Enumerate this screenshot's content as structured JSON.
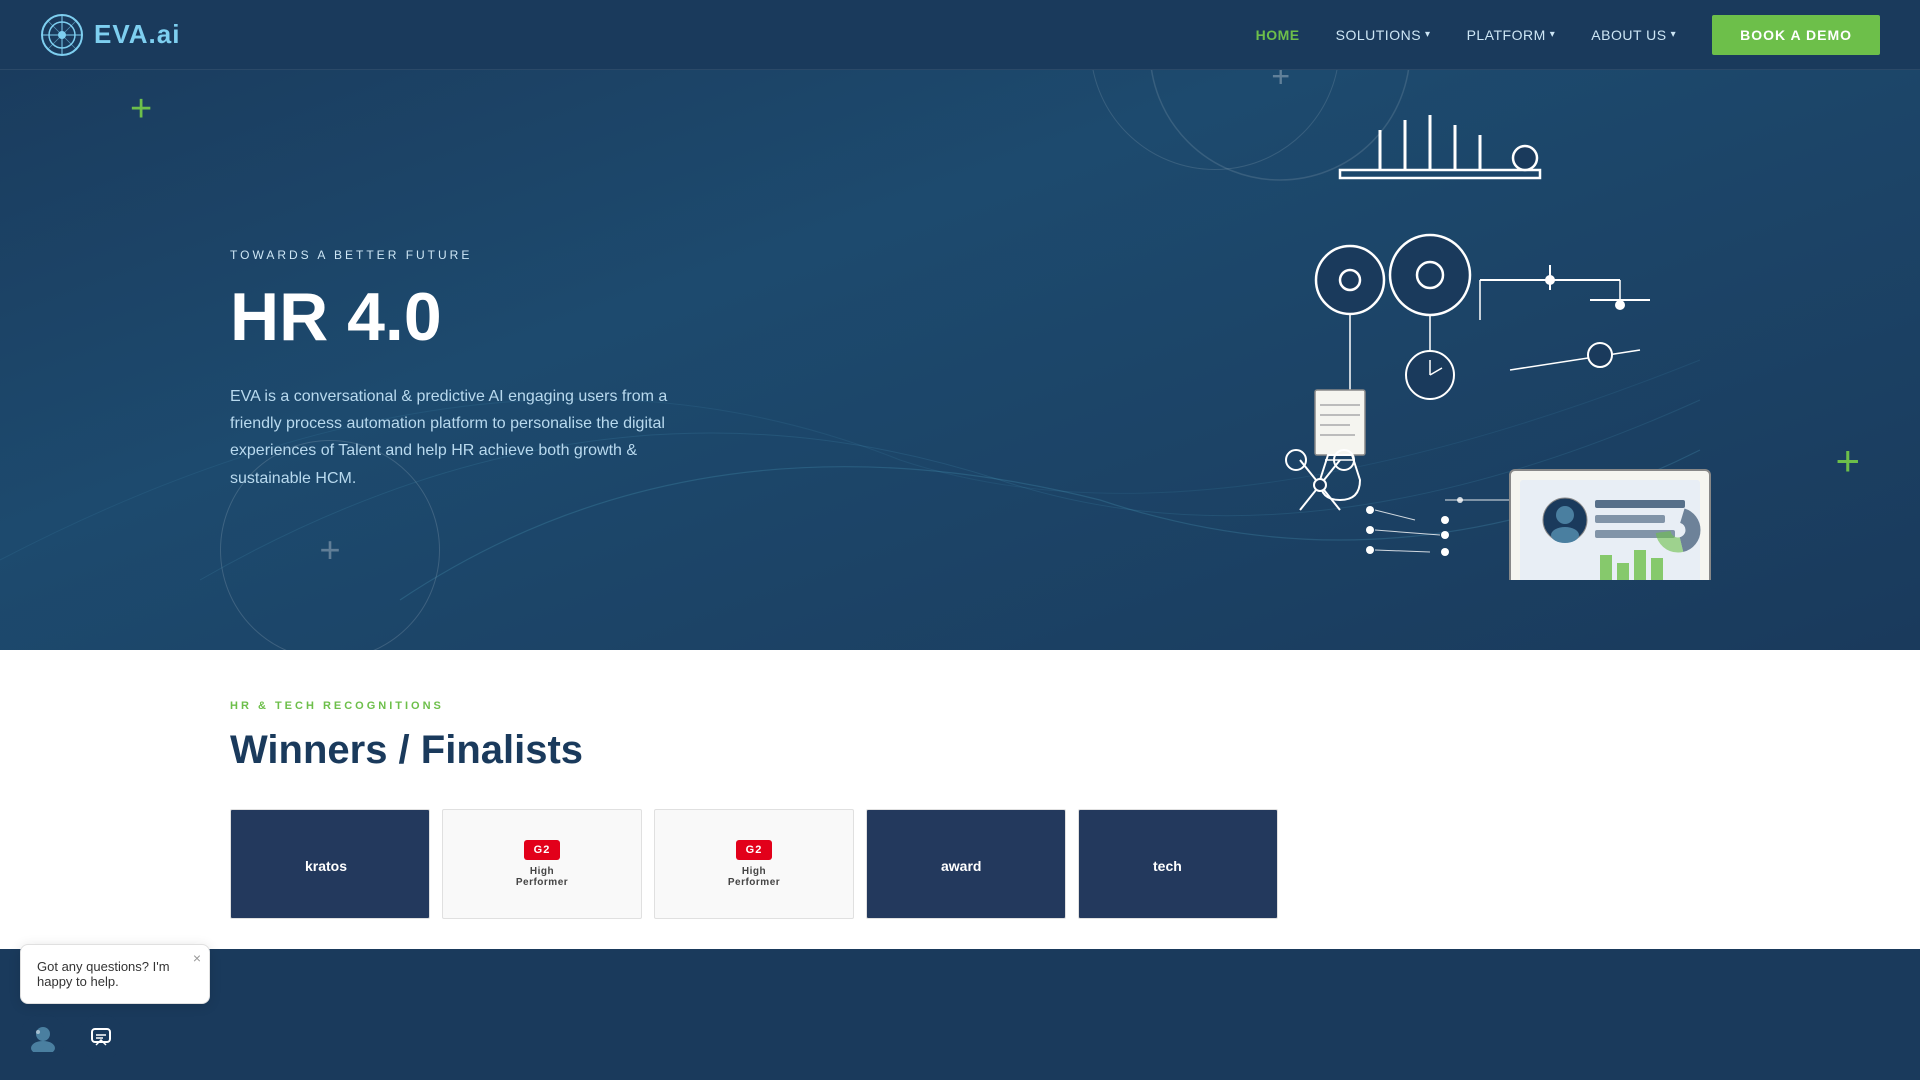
{
  "brand": {
    "logo_text": "EVA",
    "logo_suffix": ".ai"
  },
  "navbar": {
    "links": [
      {
        "id": "home",
        "label": "HOME",
        "active": true,
        "has_dropdown": false
      },
      {
        "id": "solutions",
        "label": "SOLUTIONS",
        "active": false,
        "has_dropdown": true
      },
      {
        "id": "platform",
        "label": "PLATFORM",
        "active": false,
        "has_dropdown": true
      },
      {
        "id": "about-us",
        "label": "ABOUT US",
        "active": false,
        "has_dropdown": true
      }
    ],
    "cta_label": "BOOK A DEMO"
  },
  "hero": {
    "subtitle": "TOWARDS A BETTER FUTURE",
    "title": "HR 4.0",
    "description": "EVA is a conversational & predictive AI engaging users from a friendly process automation platform to personalise the digital experiences of Talent and help HR achieve both growth & sustainable HCM."
  },
  "bottom_section": {
    "tag": "HR & TECH RECOGNITIONS",
    "title": "Winners / Finalists"
  },
  "chat_widget": {
    "message": "Got any questions? I'm happy to help.",
    "close_label": "×"
  },
  "colors": {
    "bg_primary": "#1a3a5c",
    "bg_secondary": "#1d4a6e",
    "accent_green": "#6dbf4a",
    "text_light": "#cde6f5",
    "text_white": "#ffffff",
    "red_badge": "#e2001a"
  }
}
